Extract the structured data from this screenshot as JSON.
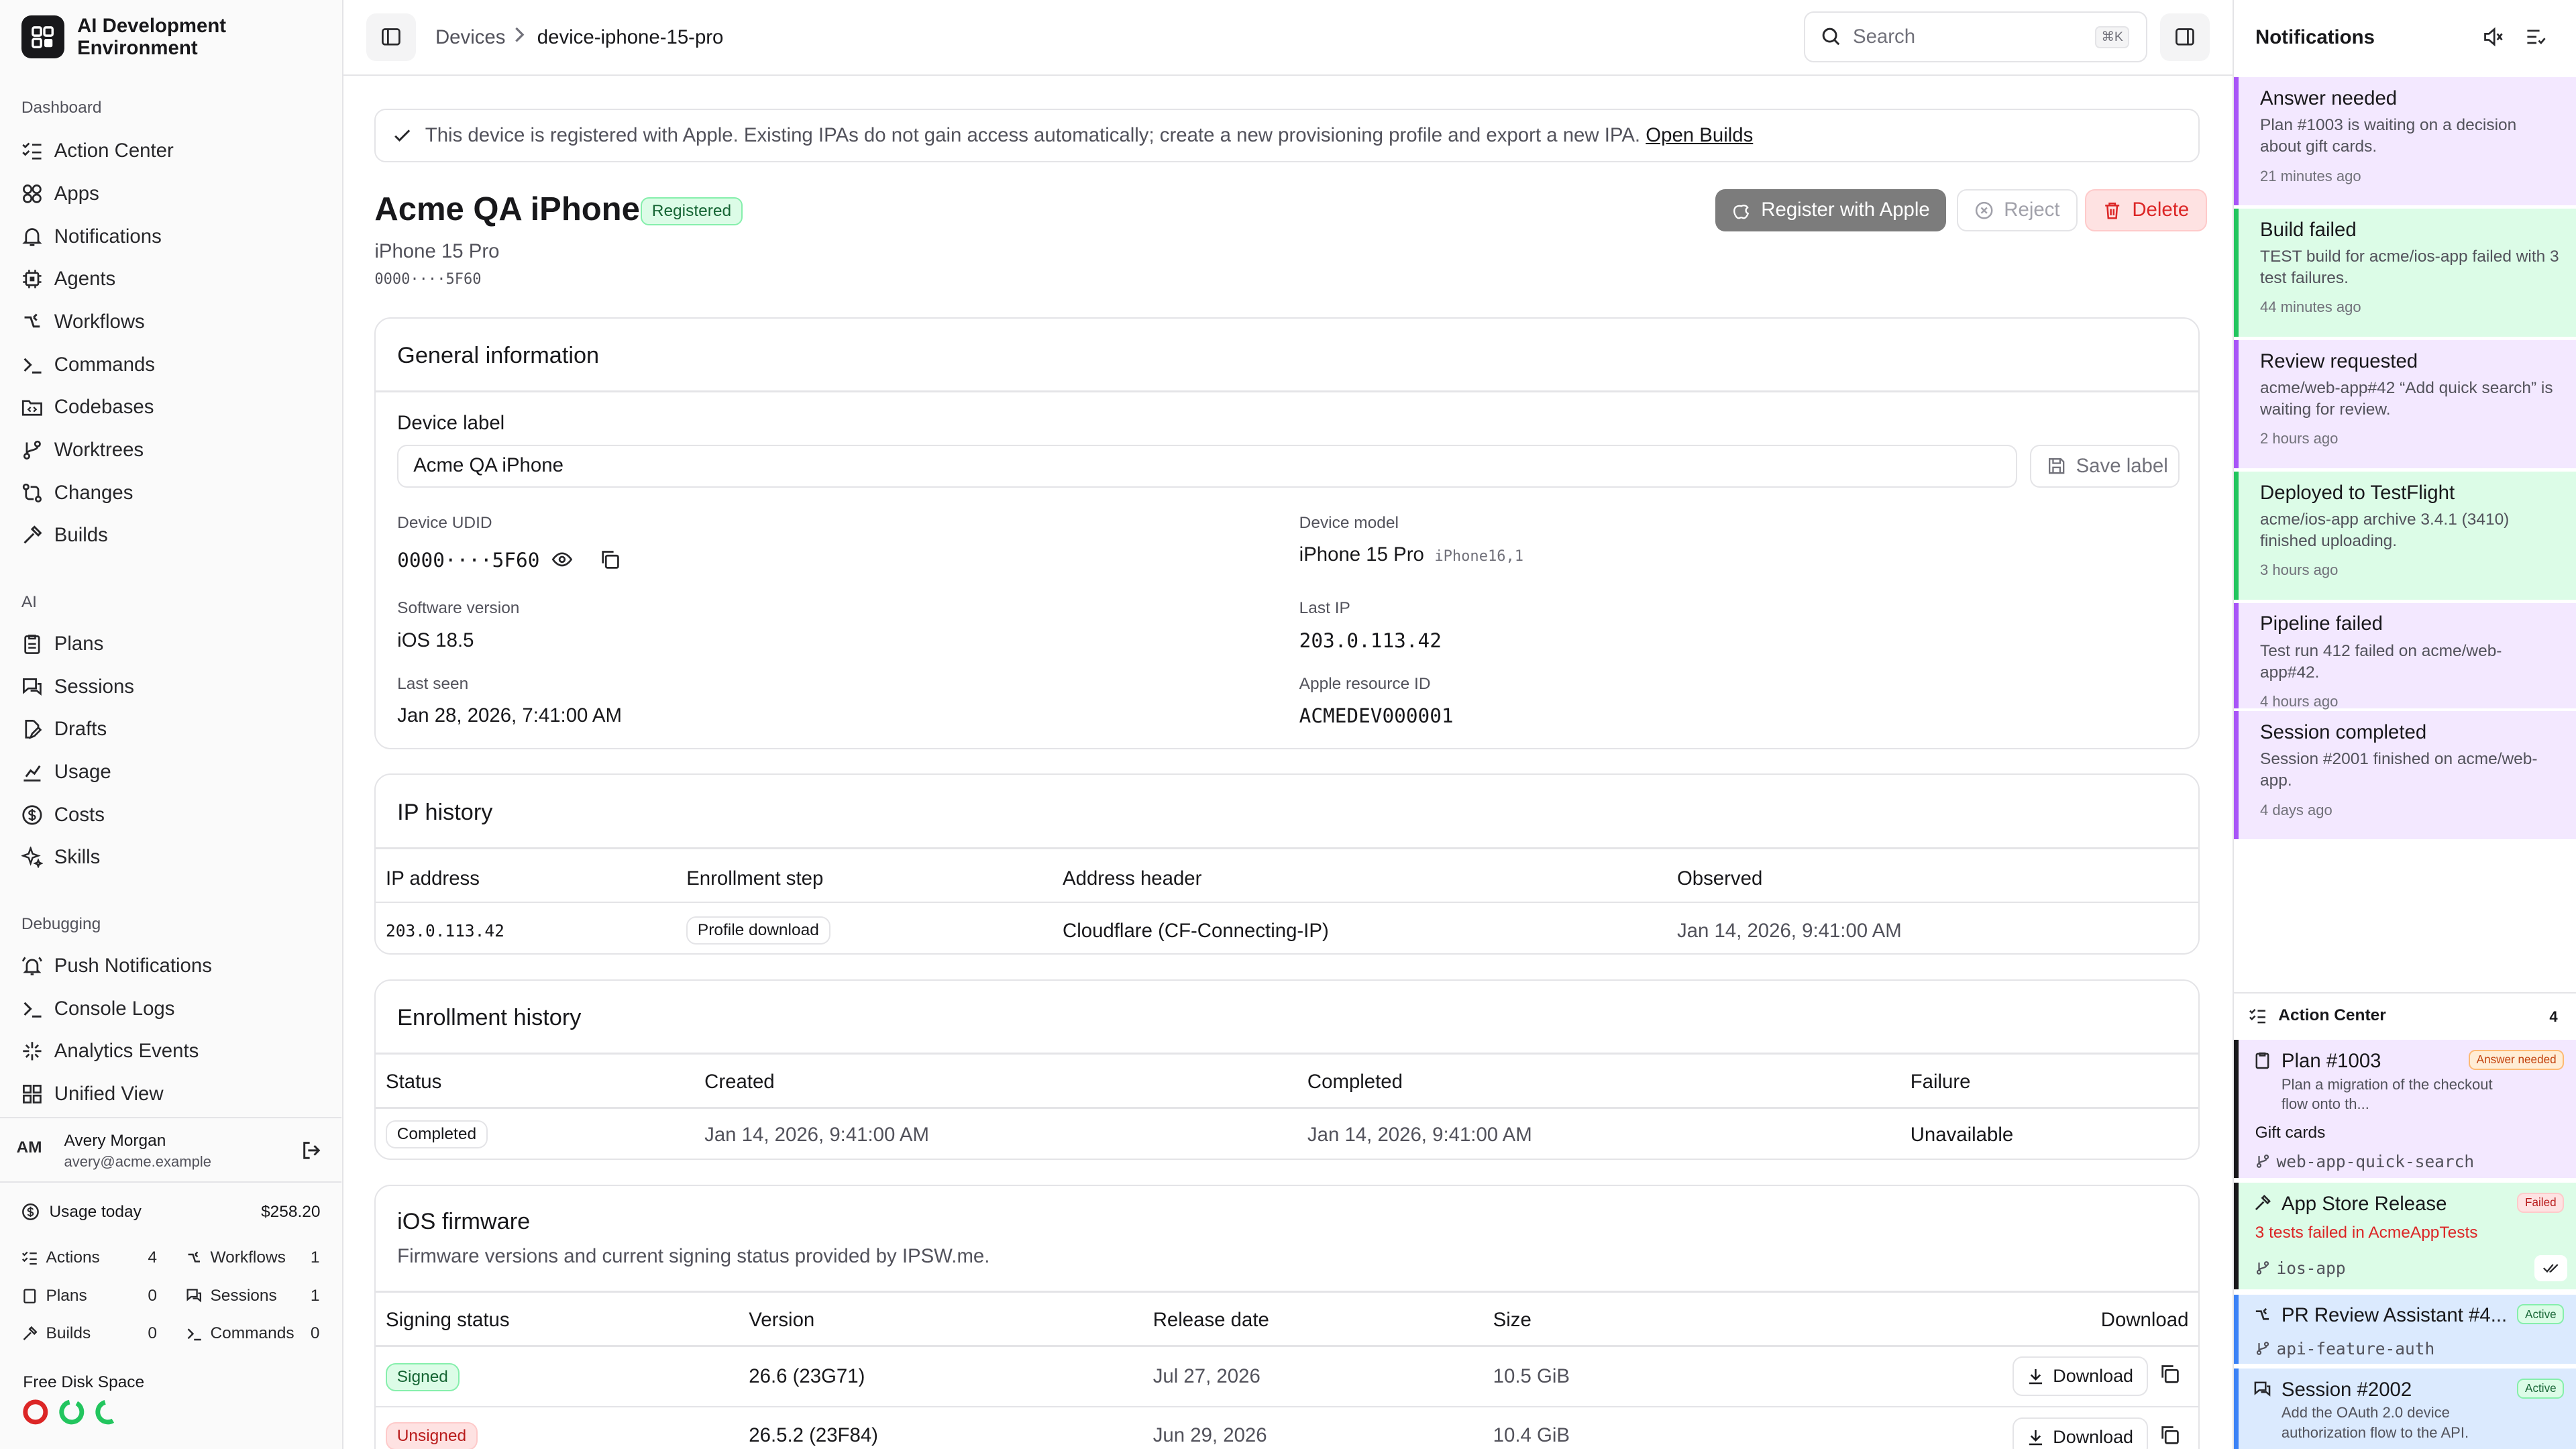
{
  "app": {
    "name": "AI Development Environment"
  },
  "sidebar": {
    "sections": [
      {
        "label": "Dashboard",
        "items": [
          {
            "label": "Action Center",
            "icon": "list-checks-icon"
          },
          {
            "label": "Apps",
            "icon": "apps-icon"
          },
          {
            "label": "Notifications",
            "icon": "bell-icon"
          },
          {
            "label": "Agents",
            "icon": "cpu-icon"
          },
          {
            "label": "Workflows",
            "icon": "workflow-icon"
          },
          {
            "label": "Commands",
            "icon": "terminal-icon"
          },
          {
            "label": "Codebases",
            "icon": "folder-code-icon"
          },
          {
            "label": "Worktrees",
            "icon": "git-branch-icon"
          },
          {
            "label": "Changes",
            "icon": "git-compare-icon"
          },
          {
            "label": "Builds",
            "icon": "hammer-icon"
          }
        ]
      },
      {
        "label": "AI",
        "items": [
          {
            "label": "Plans",
            "icon": "clipboard-icon"
          },
          {
            "label": "Sessions",
            "icon": "chat-icon"
          },
          {
            "label": "Drafts",
            "icon": "file-edit-icon"
          },
          {
            "label": "Usage",
            "icon": "chart-icon"
          },
          {
            "label": "Costs",
            "icon": "dollar-icon"
          },
          {
            "label": "Skills",
            "icon": "sparkles-icon"
          }
        ]
      },
      {
        "label": "Debugging",
        "items": [
          {
            "label": "Push Notifications",
            "icon": "bell-ring-icon"
          },
          {
            "label": "Console Logs",
            "icon": "terminal-icon"
          },
          {
            "label": "Analytics Events",
            "icon": "sparkle-icon"
          },
          {
            "label": "Unified View",
            "icon": "layout-grid-icon"
          }
        ]
      }
    ],
    "user": {
      "initials": "AM",
      "name": "Avery Morgan",
      "email": "avery@acme.example"
    },
    "usage": {
      "label": "Usage today",
      "amount": "$258.20",
      "stats": [
        {
          "label": "Actions",
          "value": "4"
        },
        {
          "label": "Workflows",
          "value": "1"
        },
        {
          "label": "Plans",
          "value": "0"
        },
        {
          "label": "Sessions",
          "value": "1"
        },
        {
          "label": "Builds",
          "value": "0"
        },
        {
          "label": "Commands",
          "value": "0"
        }
      ]
    },
    "disk": {
      "label": "Free Disk Space"
    }
  },
  "topbar": {
    "breadcrumb": [
      "Devices",
      "device-iphone-15-pro"
    ],
    "search_placeholder": "Search",
    "search_shortcut": "⌘K"
  },
  "alert": {
    "text": "This device is registered with Apple. Existing IPAs do not gain access automatically; create a new provisioning profile and export a new IPA.",
    "link": "Open Builds"
  },
  "device": {
    "title": "Acme QA iPhone",
    "status_badge": "Registered",
    "model": "iPhone 15 Pro",
    "udid_masked": "0000····5F60",
    "actions": {
      "register": "Register with Apple",
      "reject": "Reject",
      "delete": "Delete"
    }
  },
  "general": {
    "title": "General information",
    "label_field": {
      "label": "Device label",
      "value": "Acme QA iPhone",
      "save": "Save label"
    },
    "fields": {
      "udid_label": "Device UDID",
      "udid_value": "0000····5F60",
      "model_label": "Device model",
      "model_value": "iPhone 15 Pro",
      "model_id": "iPhone16,1",
      "software_label": "Software version",
      "software_value": "iOS 18.5",
      "ip_label": "Last IP",
      "ip_value": "203.0.113.42",
      "seen_label": "Last seen",
      "seen_value": "Jan 28, 2026, 7:41:00 AM",
      "apple_label": "Apple resource ID",
      "apple_value": "ACMEDEV000001"
    }
  },
  "ip_history": {
    "title": "IP history",
    "columns": [
      "IP address",
      "Enrollment step",
      "Address header",
      "Observed"
    ],
    "rows": [
      {
        "ip": "203.0.113.42",
        "step": "Profile download",
        "header": "Cloudflare (CF-Connecting-IP)",
        "observed": "Jan 14, 2026, 9:41:00 AM"
      }
    ]
  },
  "enrollment": {
    "title": "Enrollment history",
    "columns": [
      "Status",
      "Created",
      "Completed",
      "Failure"
    ],
    "rows": [
      {
        "status": "Completed",
        "created": "Jan 14, 2026, 9:41:00 AM",
        "completed": "Jan 14, 2026, 9:41:00 AM",
        "failure": "Unavailable"
      }
    ]
  },
  "firmware": {
    "title": "iOS firmware",
    "subtitle": "Firmware versions and current signing status provided by IPSW.me.",
    "columns": [
      "Signing status",
      "Version",
      "Release date",
      "Size",
      "Download"
    ],
    "rows": [
      {
        "status": "Signed",
        "version": "26.6 (23G71)",
        "date": "Jul 27, 2026",
        "size": "10.5 GiB",
        "download": "Download"
      },
      {
        "status": "Unsigned",
        "version": "26.5.2 (23F84)",
        "date": "Jun 29, 2026",
        "size": "10.4 GiB",
        "download": "Download"
      }
    ]
  },
  "notifications": {
    "title": "Notifications",
    "items": [
      {
        "title": "Answer needed",
        "body": "Plan #1003 is waiting on a decision about gift cards.",
        "time": "21 minutes ago",
        "tone": "purple"
      },
      {
        "title": "Build failed",
        "body": "TEST build for acme/ios-app failed with 3 test failures.",
        "time": "44 minutes ago",
        "tone": "green"
      },
      {
        "title": "Review requested",
        "body": "acme/web-app#42 “Add quick search” is waiting for review.",
        "time": "2 hours ago",
        "tone": "purple"
      },
      {
        "title": "Deployed to TestFlight",
        "body": "acme/ios-app archive 3.4.1 (3410) finished uploading.",
        "time": "3 hours ago",
        "tone": "green"
      },
      {
        "title": "Pipeline failed",
        "body": "Test run 412 failed on acme/web-app#42.",
        "time": "4 hours ago",
        "tone": "purple"
      },
      {
        "title": "Session completed",
        "body": "Session #2001 finished on acme/web-app.",
        "time": "4 days ago",
        "tone": "purple"
      }
    ]
  },
  "action_center": {
    "title": "Action Center",
    "count": "4",
    "items": [
      {
        "title": "Plan #1003",
        "tag": "Answer needed",
        "desc": "Plan a migration of the checkout flow onto th...",
        "extra": "Gift cards",
        "branch": "web-app-quick-search"
      },
      {
        "title": "App Store Release",
        "tag": "Failed",
        "desc": "3 tests failed in AcmeAppTests",
        "branch": "ios-app"
      },
      {
        "title": "PR Review Assistant #4...",
        "tag": "Active",
        "branch": "api-feature-auth"
      },
      {
        "title": "Session #2002",
        "tag": "Active",
        "desc": "Add the OAuth 2.0 device authorization flow to the API."
      }
    ]
  },
  "colors": {
    "accent": "#18181b",
    "success": "#16a34a",
    "danger": "#dc2626",
    "notif_purple": "#a855f7",
    "notif_green": "#22c55e",
    "active_blue": "#3b82f6"
  }
}
